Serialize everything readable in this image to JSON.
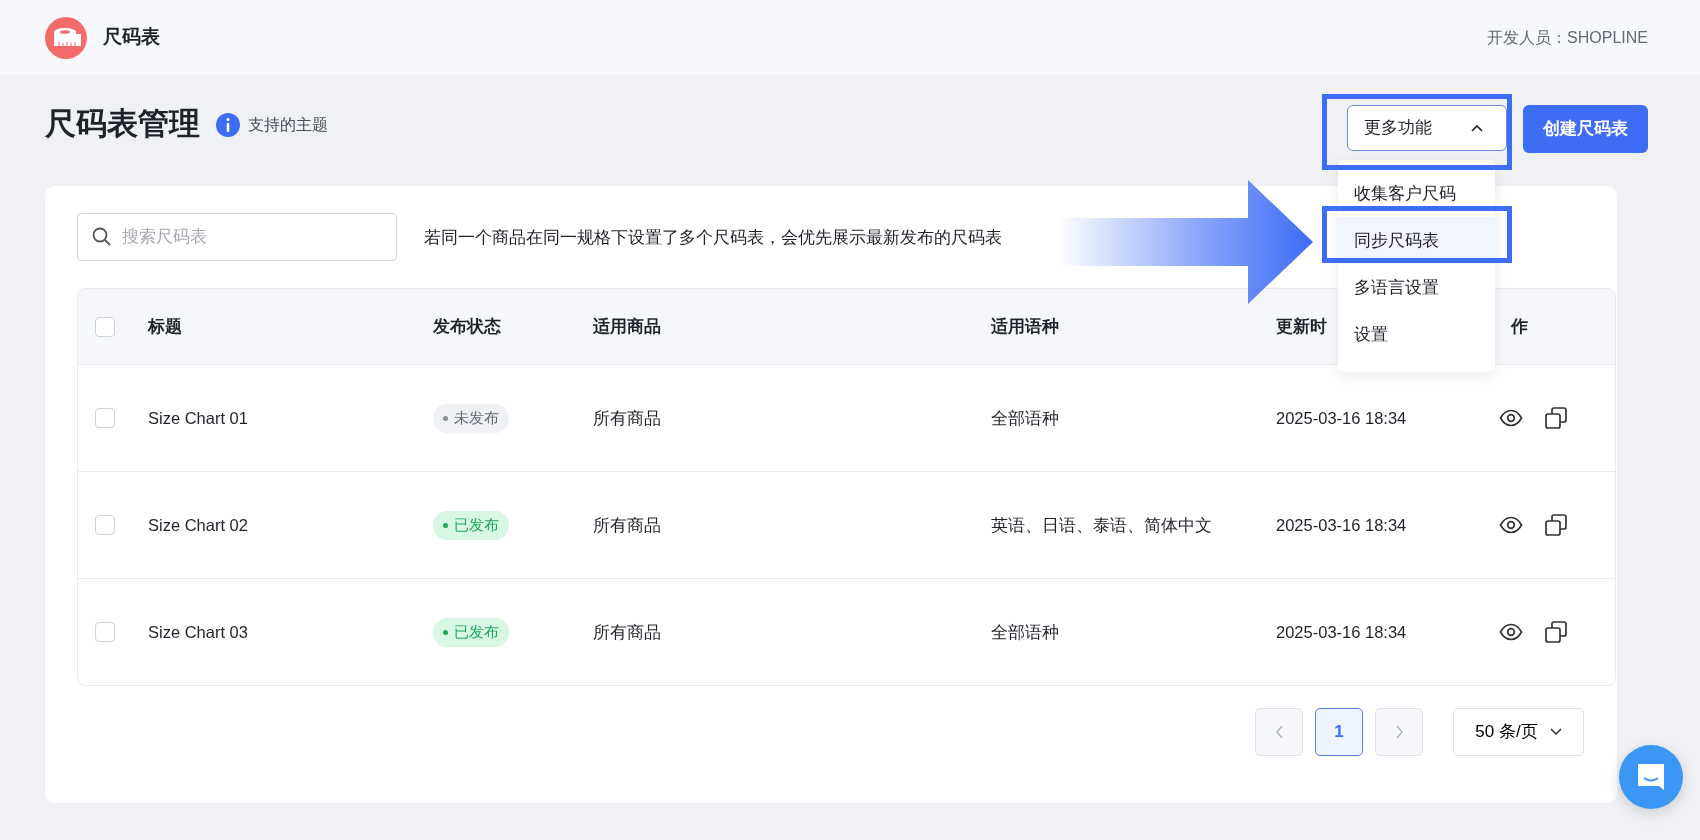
{
  "app": {
    "title": "尺码表",
    "developer": "开发人员：SHOPLINE"
  },
  "page": {
    "title": "尺码表管理",
    "help_link": "支持的主题"
  },
  "more_menu": {
    "label": "更多功能",
    "expanded": true,
    "items": [
      {
        "label": "收集客户尺码",
        "selected": false
      },
      {
        "label": "同步尺码表",
        "selected": true
      },
      {
        "label": "多语言设置",
        "selected": false
      },
      {
        "label": "设置",
        "selected": false
      }
    ]
  },
  "create_button": "创建尺码表",
  "search": {
    "placeholder": "搜索尺码表"
  },
  "hint": "若同一个商品在同一规格下设置了多个尺码表，会优先展示最新发布的尺码表",
  "table": {
    "all_checked": false,
    "columns": [
      "标题",
      "发布状态",
      "适用商品",
      "适用语种",
      "更新时",
      "作"
    ],
    "rows": [
      {
        "checked": false,
        "title": "Size Chart 01",
        "status": {
          "label": "未发布",
          "kind": "unpublished"
        },
        "products": "所有商品",
        "languages": "全部语种",
        "updated": "2025-03-16 18:34"
      },
      {
        "checked": false,
        "title": "Size Chart 02",
        "status": {
          "label": "已发布",
          "kind": "published"
        },
        "products": "所有商品",
        "languages": "英语、日语、泰语、简体中文",
        "updated": "2025-03-16 18:34"
      },
      {
        "checked": false,
        "title": "Size Chart 03",
        "status": {
          "label": "已发布",
          "kind": "published"
        },
        "products": "所有商品",
        "languages": "全部语种",
        "updated": "2025-03-16 18:34"
      }
    ]
  },
  "pagination": {
    "prev_disabled": true,
    "next_disabled": true,
    "pages": [
      {
        "label": "1",
        "selected": true
      }
    ],
    "page_size": "50 条/页"
  }
}
